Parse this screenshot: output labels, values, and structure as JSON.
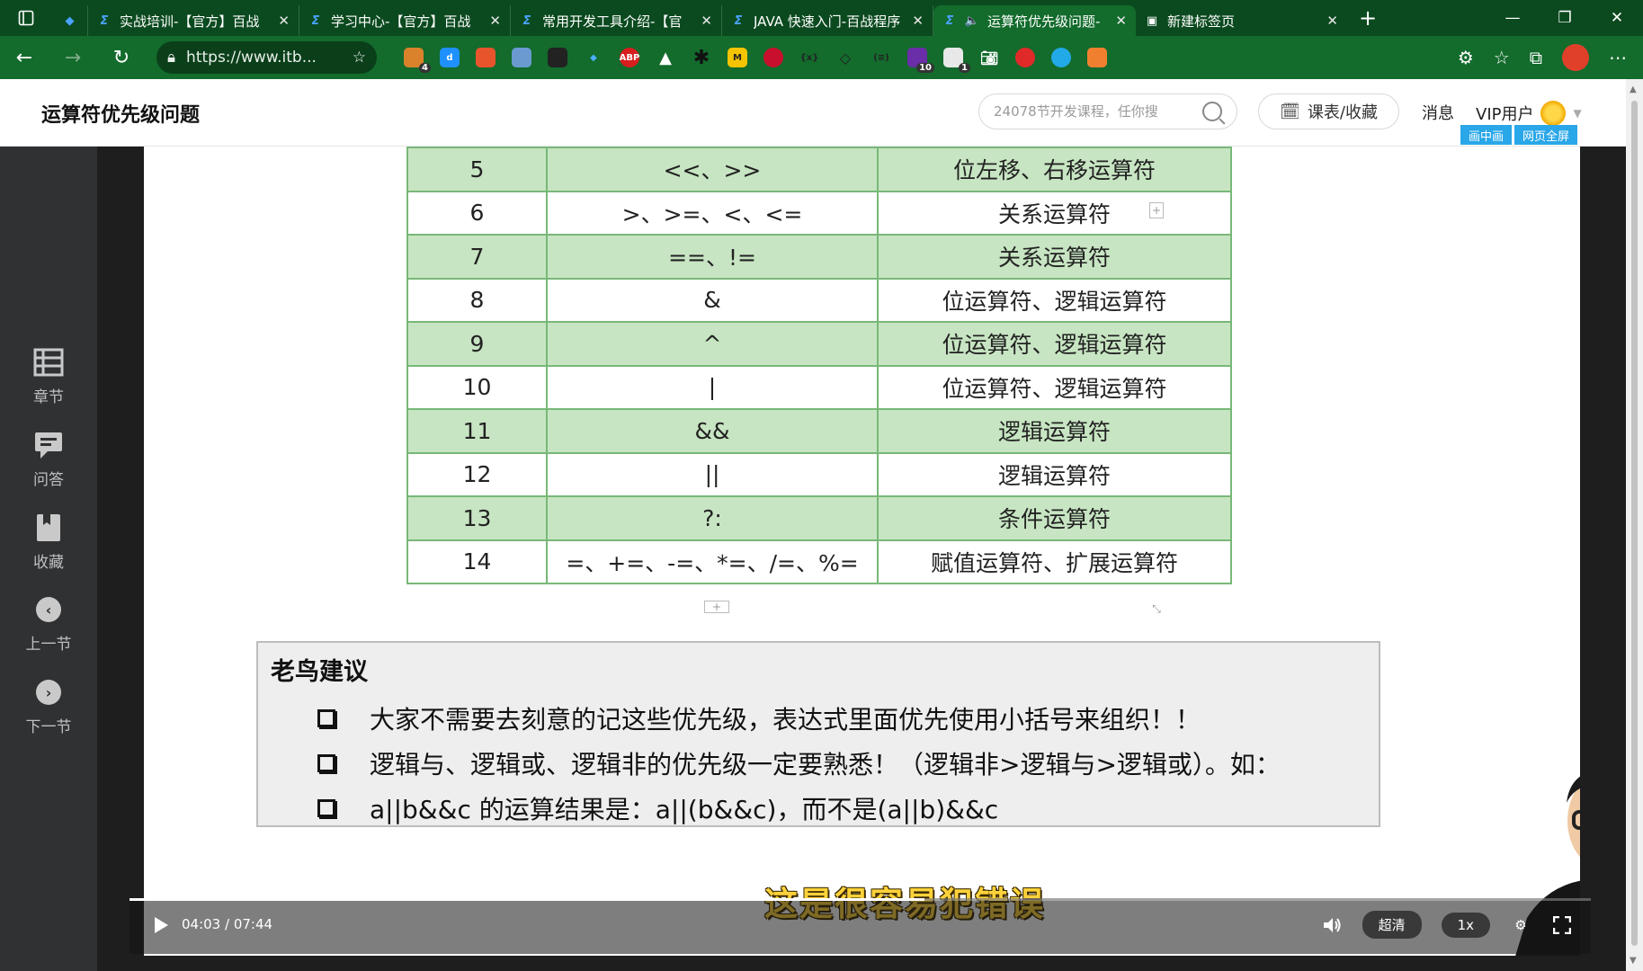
{
  "browser": {
    "tabs": [
      {
        "title": "",
        "icon": "gem-icon",
        "first": true
      },
      {
        "title": "实战培训-【官方】百战",
        "icon": "site-icon"
      },
      {
        "title": "学习中心-【官方】百战",
        "icon": "site-icon"
      },
      {
        "title": "常用开发工具介绍-【官",
        "icon": "site-icon"
      },
      {
        "title": "JAVA 快速入门-百战程序",
        "icon": "site-icon"
      },
      {
        "title": "运算符优先级问题-",
        "icon": "site-icon",
        "active": true,
        "audio": true
      },
      {
        "title": "新建标签页",
        "icon": "newtab-page-icon"
      }
    ],
    "url": "https://www.itb...",
    "extension_badges": {
      "first": "4",
      "tenth": "10",
      "eleventh": "1"
    },
    "ext_labels": {
      "abp": "ABP",
      "m": "M"
    }
  },
  "header": {
    "title": "运算符优先级问题",
    "search_placeholder": "24078节开发课程，任你搜",
    "schedule_label": "课表/收藏",
    "messages_label": "消息",
    "vip_label": "VIP用户",
    "pip_label": "画中画",
    "webfull_label": "网页全屏"
  },
  "sidebar": {
    "items": [
      {
        "label": "章节",
        "icon": "chapters-icon"
      },
      {
        "label": "问答",
        "icon": "qa-icon"
      },
      {
        "label": "收藏",
        "icon": "bookmark-icon"
      },
      {
        "label": "上一节",
        "icon": "prev-icon"
      },
      {
        "label": "下一节",
        "icon": "next-icon"
      }
    ]
  },
  "slide": {
    "table_rows": [
      {
        "priority": "5",
        "operators": "<<、>>",
        "type": "位左移、右移运算符"
      },
      {
        "priority": "6",
        "operators": ">、>=、<、<=",
        "type": "关系运算符"
      },
      {
        "priority": "7",
        "operators": "==、!=",
        "type": "关系运算符"
      },
      {
        "priority": "8",
        "operators": "&",
        "type": "位运算符、逻辑运算符"
      },
      {
        "priority": "9",
        "operators": "^",
        "type": "位运算符、逻辑运算符"
      },
      {
        "priority": "10",
        "operators": "|",
        "type": "位运算符、逻辑运算符"
      },
      {
        "priority": "11",
        "operators": "&&",
        "type": "逻辑运算符"
      },
      {
        "priority": "12",
        "operators": "||",
        "type": "逻辑运算符"
      },
      {
        "priority": "13",
        "operators": "?:",
        "type": "条件运算符"
      },
      {
        "priority": "14",
        "operators": "=、+=、-=、*=、/=、%=",
        "type": "赋值运算符、扩展运算符"
      }
    ],
    "advice_title": "老鸟建议",
    "advice_items": [
      "大家不需要去刻意的记这些优先级，表达式里面优先使用小括号来组织！！",
      "逻辑与、逻辑或、逻辑非的优先级一定要熟悉！（逻辑非>逻辑与>逻辑或）。如：",
      "a||b&&c 的运算结果是：a||(b&&c)，而不是(a||b)&&c"
    ],
    "subtitle": "这是很容易犯错误"
  },
  "player": {
    "current_time": "04:03",
    "duration": "07:44",
    "time_display": "04:03 / 07:44",
    "progress": 0.544,
    "quality_label": "超清",
    "speed_label": "1x"
  }
}
